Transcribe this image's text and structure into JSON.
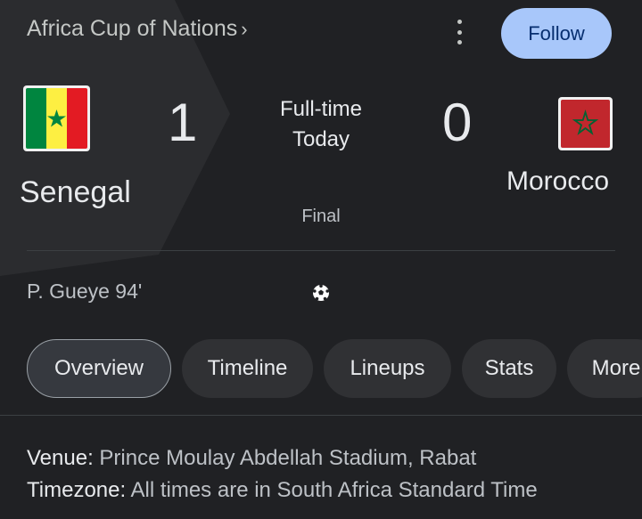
{
  "header": {
    "competition": "Africa Cup of Nations",
    "follow_label": "Follow"
  },
  "match": {
    "home_team": "Senegal",
    "away_team": "Morocco",
    "home_score": "1",
    "away_score": "0",
    "status_line1": "Full-time",
    "status_line2": "Today",
    "stage": "Final",
    "scorer": "P. Gueye 94'"
  },
  "tabs": [
    "Overview",
    "Timeline",
    "Lineups",
    "Stats",
    "More"
  ],
  "info": {
    "venue_label": "Venue:",
    "venue_value": "Prince Moulay Abdellah Stadium, Rabat",
    "timezone_label": "Timezone:",
    "timezone_value": "All times are in South Africa Standard Time"
  },
  "colors": {
    "background": "#202124",
    "winner_highlight": "#2b2c2f",
    "follow_button": "#a8c7fa",
    "tab_background": "#303134"
  },
  "icons": {
    "menu": "more-vert-icon",
    "goal": "soccer-ball-icon",
    "home_flag": "senegal-flag-icon",
    "away_flag": "morocco-flag-icon"
  }
}
